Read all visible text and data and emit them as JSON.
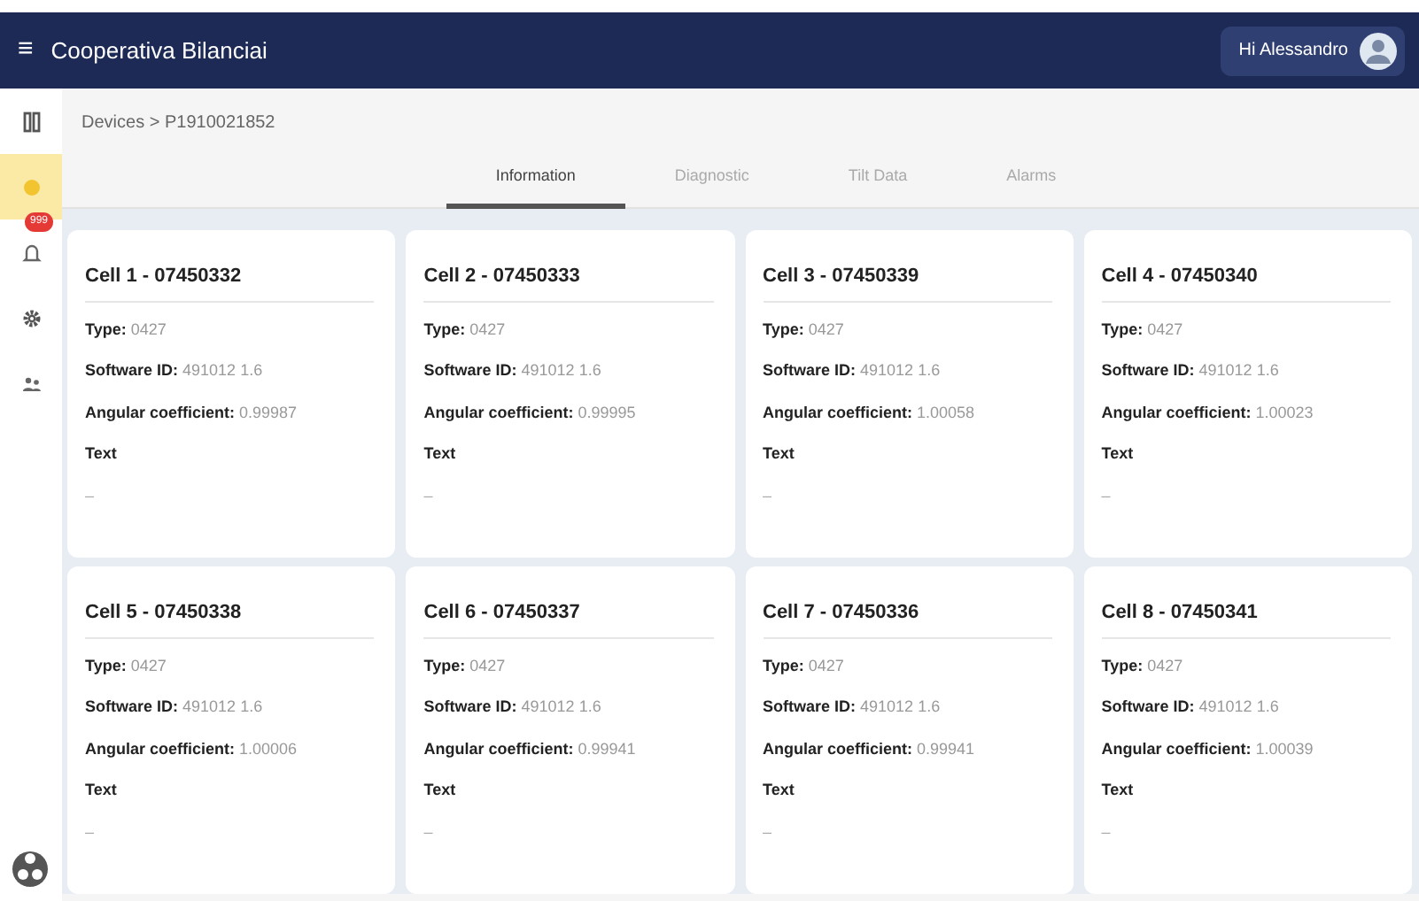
{
  "app_bar": {
    "menu_icon": "≡",
    "title": "Cooperativa Bilanciai",
    "user_greeting": "Hi Alessandro"
  },
  "sidebar": {
    "items": [
      {
        "kind": "device",
        "selected": false
      },
      {
        "kind": "dot",
        "selected": true
      },
      {
        "kind": "bell",
        "selected": false,
        "badge": "999"
      },
      {
        "kind": "gear",
        "selected": false
      },
      {
        "kind": "people",
        "selected": false
      }
    ]
  },
  "breadcrumb": "Devices > P1910021852",
  "tabs": [
    {
      "label": "Information",
      "selected": true
    },
    {
      "label": "Diagnostic",
      "selected": false
    },
    {
      "label": "Tilt Data",
      "selected": false
    },
    {
      "label": "Alarms",
      "selected": false
    }
  ],
  "cells": [
    {
      "title": "Cell 1 - 07450332",
      "fields": [
        {
          "label": "Type:",
          "value": "0427"
        },
        {
          "label": "Software ID:",
          "value": "491012 1.6"
        },
        {
          "label": "Angular coefficient:",
          "value": "0.99987"
        }
      ],
      "text_label": "Text",
      "text_value": "–"
    },
    {
      "title": "Cell 2 - 07450333",
      "fields": [
        {
          "label": "Type:",
          "value": "0427"
        },
        {
          "label": "Software ID:",
          "value": "491012 1.6"
        },
        {
          "label": "Angular coefficient:",
          "value": "0.99995"
        }
      ],
      "text_label": "Text",
      "text_value": "–"
    },
    {
      "title": "Cell 3 - 07450339",
      "fields": [
        {
          "label": "Type:",
          "value": "0427"
        },
        {
          "label": "Software ID:",
          "value": "491012 1.6"
        },
        {
          "label": "Angular coefficient:",
          "value": "1.00058"
        }
      ],
      "text_label": "Text",
      "text_value": "–"
    },
    {
      "title": "Cell 4 - 07450340",
      "fields": [
        {
          "label": "Type:",
          "value": "0427"
        },
        {
          "label": "Software ID:",
          "value": "491012 1.6"
        },
        {
          "label": "Angular coefficient:",
          "value": "1.00023"
        }
      ],
      "text_label": "Text",
      "text_value": "–"
    },
    {
      "title": "Cell 5 - 07450338",
      "fields": [
        {
          "label": "Type:",
          "value": "0427"
        },
        {
          "label": "Software ID:",
          "value": "491012 1.6"
        },
        {
          "label": "Angular coefficient:",
          "value": "1.00006"
        }
      ],
      "text_label": "Text",
      "text_value": "–"
    },
    {
      "title": "Cell 6 - 07450337",
      "fields": [
        {
          "label": "Type:",
          "value": "0427"
        },
        {
          "label": "Software ID:",
          "value": "491012 1.6"
        },
        {
          "label": "Angular coefficient:",
          "value": "0.99941"
        }
      ],
      "text_label": "Text",
      "text_value": "–"
    },
    {
      "title": "Cell 7 - 07450336",
      "fields": [
        {
          "label": "Type:",
          "value": "0427"
        },
        {
          "label": "Software ID:",
          "value": "491012 1.6"
        },
        {
          "label": "Angular coefficient:",
          "value": "0.99941"
        }
      ],
      "text_label": "Text",
      "text_value": "–"
    },
    {
      "title": "Cell 8 - 07450341",
      "fields": [
        {
          "label": "Type:",
          "value": "0427"
        },
        {
          "label": "Software ID:",
          "value": "491012 1.6"
        },
        {
          "label": "Angular coefficient:",
          "value": "1.00039"
        }
      ],
      "text_label": "Text",
      "text_value": "–"
    }
  ]
}
